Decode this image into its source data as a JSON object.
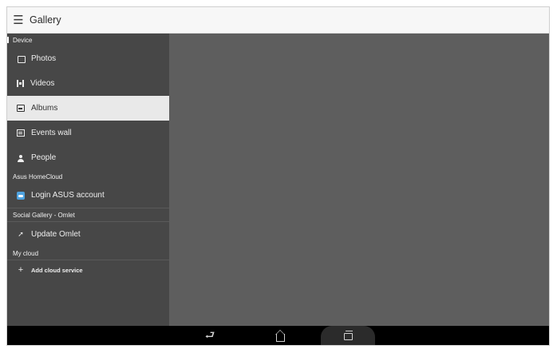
{
  "app": {
    "title": "Gallery"
  },
  "header": {
    "menu_icon": "menu-icon"
  },
  "drawer": {
    "sections": [
      {
        "title": "Device",
        "items": [
          {
            "label": "Photos",
            "icon": "photos-icon"
          },
          {
            "label": "Videos",
            "icon": "video-icon"
          },
          {
            "label": "Albums",
            "icon": "album-icon",
            "selected": true
          },
          {
            "label": "Events wall",
            "icon": "events-icon"
          },
          {
            "label": "People",
            "icon": "people-icon"
          }
        ]
      },
      {
        "title": "Asus HomeCloud",
        "items": [
          {
            "label": "Login ASUS account",
            "icon": "homecloud-icon"
          }
        ]
      },
      {
        "title": "Social Gallery - Omlet",
        "items": [
          {
            "label": "Update Omlet",
            "icon": "pin-icon"
          }
        ]
      },
      {
        "title": "My cloud",
        "items": [
          {
            "label": "Add cloud service",
            "icon": "plus-icon"
          }
        ]
      }
    ]
  },
  "navbar": {
    "back": "back-icon",
    "home": "home-icon",
    "recents": "recents-icon"
  },
  "colors": {
    "drawer_bg": "#474747",
    "content_bg": "#5e5e5e",
    "selected_bg": "#e9e9e9",
    "appbar_bg": "#f7f7f7",
    "navbar_bg": "#000000",
    "homecloud_accent": "#4fa3e0"
  }
}
